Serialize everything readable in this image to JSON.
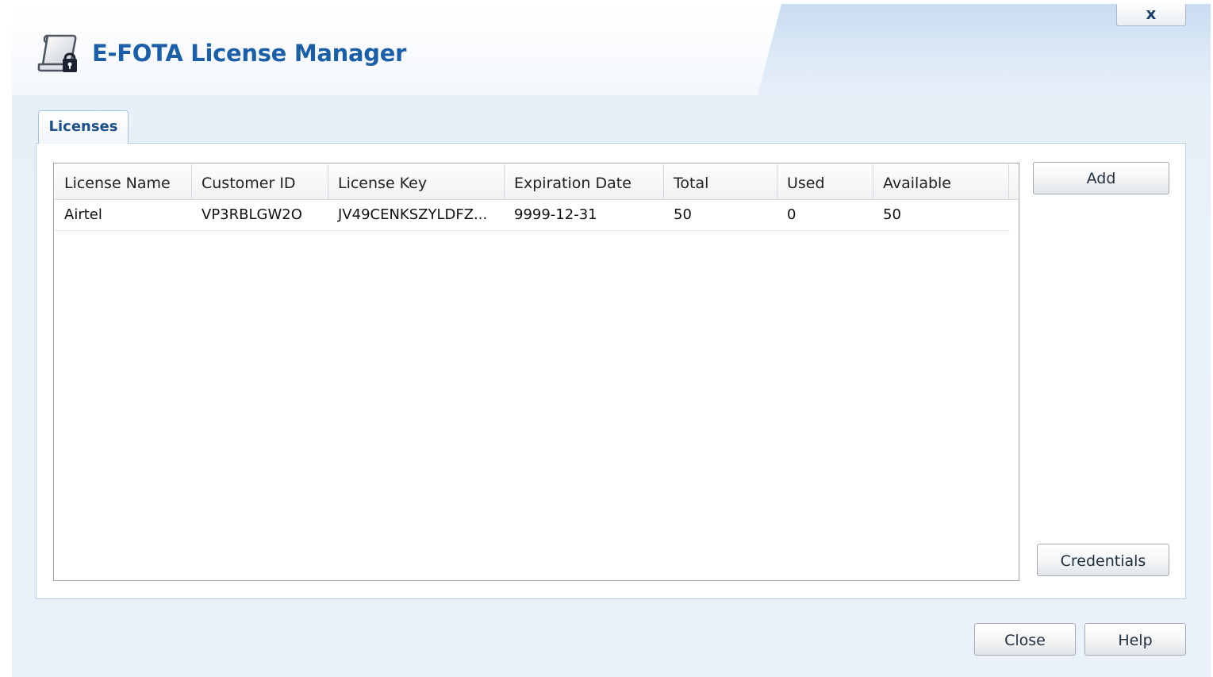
{
  "window": {
    "title": "E-FOTA License Manager",
    "close_glyph": "x",
    "title_icon": "license-scroll-lock-icon"
  },
  "tabs": [
    {
      "label": "Licenses",
      "active": true
    }
  ],
  "licenses_table": {
    "columns": [
      "License Name",
      "Customer ID",
      "License Key",
      "Expiration Date",
      "Total",
      "Used",
      "Available"
    ],
    "rows": [
      [
        "Airtel",
        "VP3RBLGW2O",
        "JV49CENKSZYLDFZ...",
        "9999-12-31",
        "50",
        "0",
        "50"
      ]
    ]
  },
  "buttons": {
    "add": "Add",
    "credentials": "Credentials",
    "close": "Close",
    "help": "Help"
  },
  "colors": {
    "title": "#1a5fa8",
    "tab_label": "#1d4f8c",
    "dialog_bg": "#eaf1fa"
  }
}
